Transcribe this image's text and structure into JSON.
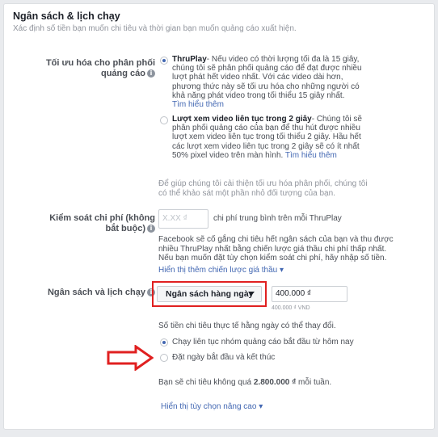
{
  "section": {
    "title": "Ngân sách & lịch chạy",
    "subtitle": "Xác định số tiền bạn muốn chi tiêu và thời gian bạn muốn quảng cáo xuất hiện."
  },
  "optimization": {
    "label": "Tối ưu hóa cho phân phối quảng cáo",
    "options": [
      {
        "title": "ThruPlay",
        "desc": "- Nếu video có thời lượng tối đa là 15 giây, chúng tôi sẽ phân phối quảng cáo để đạt được nhiều lượt phát hết video nhất. Với các video dài hơn, phương thức này sẽ tối ưu hóa cho những người có khả năng phát video trong tối thiểu 15 giây nhất.",
        "link": "Tìm hiểu thêm",
        "selected": true
      },
      {
        "title": "Lượt xem video liên tục trong 2 giây",
        "desc": "- Chúng tôi sẽ phân phối quảng cáo của bạn để thu hút được nhiều lượt xem video liên tục trong tối thiểu 2 giây. Hầu hết các lượt xem video liên tục trong 2 giây sẽ có ít nhất 50% pixel video trên màn hình.",
        "link": "Tìm hiểu thêm",
        "selected": false
      }
    ],
    "help": "Để giúp chúng tôi cải thiện tối ưu hóa phân phối, chúng tôi có thể khảo sát một phần nhỏ đối tượng của bạn."
  },
  "cost_control": {
    "label": "Kiểm soát chi phí (không bắt buộc)",
    "placeholder": "X.XX ₫",
    "suffix": "chi phí trung bình trên mỗi ThruPlay",
    "description": "Facebook sẽ cố gắng chi tiêu hết ngân sách của bạn và thu được nhiều ThruPlay nhất bằng chiến lược giá thầu chi phí thấp nhất. Nếu bạn muốn đặt tùy chọn kiểm soát chi phí, hãy nhập số tiền.",
    "more_link": "Hiển thị thêm chiến lược giá thầu ▾"
  },
  "budget": {
    "label": "Ngân sách và lịch chạy",
    "type": "Ngân sách hàng ngày",
    "amount": "400.000 ₫",
    "amount_note": "400.000 ₫ VND",
    "note": "Số tiền chi tiêu thực tế hằng ngày có thể thay đổi.",
    "schedule_options": [
      {
        "label": "Chạy liên tục nhóm quảng cáo bắt đầu từ hôm nay",
        "selected": true
      },
      {
        "label": "Đặt ngày bắt đầu và kết thúc",
        "selected": false
      }
    ],
    "weekly_prefix": "Bạn sẽ chi tiêu không quá ",
    "weekly_amount": "2.800.000 ₫",
    "weekly_suffix": " mỗi tuần.",
    "advanced_link": "Hiển thị tùy chọn nâng cao ▾"
  },
  "colors": {
    "link": "#4267b2",
    "highlight": "#e02020",
    "radio_selected": "#4267b2"
  }
}
